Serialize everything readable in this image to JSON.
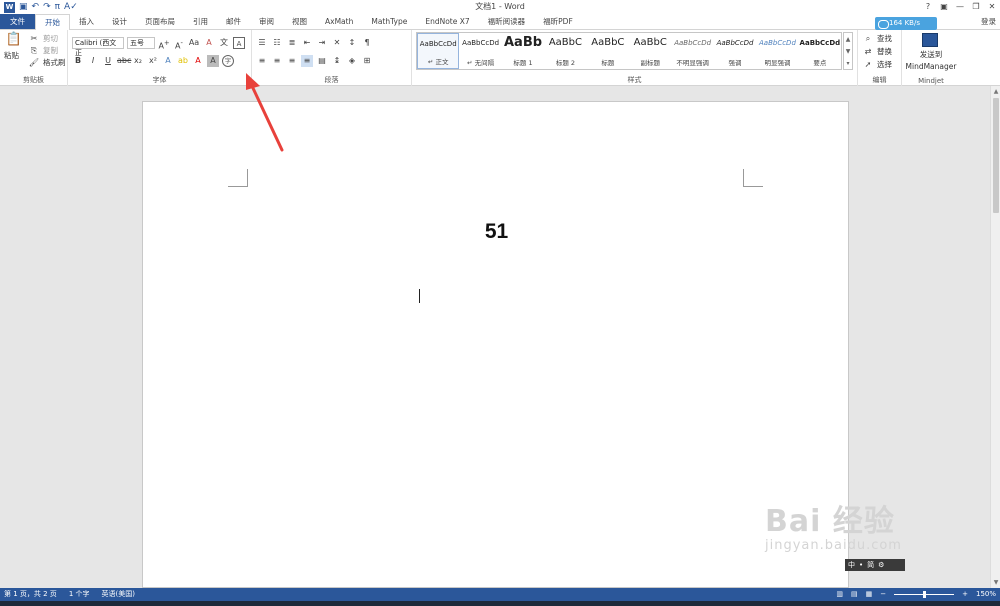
{
  "window": {
    "title": "文档1 - Word",
    "controls": [
      "?",
      "▣",
      "—",
      "❐",
      "✕"
    ]
  },
  "qat": {
    "icons": [
      "word-logo",
      "save-icon",
      "undo-icon",
      "redo-icon",
      "pi-icon",
      "spelling-icon"
    ],
    "pi_label": "π",
    "logo_label": "W"
  },
  "tabs": [
    {
      "label": "文件"
    },
    {
      "label": "开始"
    },
    {
      "label": "插入"
    },
    {
      "label": "设计"
    },
    {
      "label": "页面布局"
    },
    {
      "label": "引用"
    },
    {
      "label": "邮件"
    },
    {
      "label": "审阅"
    },
    {
      "label": "视图"
    },
    {
      "label": "AxMath"
    },
    {
      "label": "MathType"
    },
    {
      "label": "EndNote X7"
    },
    {
      "label": "福昕阅读器"
    },
    {
      "label": "福昕PDF"
    }
  ],
  "login": "登录",
  "cloud_speed": "164 KB/s",
  "ribbon": {
    "clipboard": {
      "label": "剪贴板",
      "paste": "粘贴",
      "cut": "剪切",
      "copy": "复制",
      "format_painter": "格式刷"
    },
    "font": {
      "label": "字体",
      "font_name": "Calibri (西文正",
      "font_size": "五号"
    },
    "paragraph": {
      "label": "段落"
    },
    "styles": {
      "label": "样式",
      "items": [
        {
          "sample": "AaBbCcDd",
          "name": "↵ 正文"
        },
        {
          "sample": "AaBbCcDd",
          "name": "↵ 无间隔"
        },
        {
          "sample": "AaBb",
          "name": "标题 1"
        },
        {
          "sample": "AaBbC",
          "name": "标题 2"
        },
        {
          "sample": "AaBbC",
          "name": "标题"
        },
        {
          "sample": "AaBbC",
          "name": "副标题"
        },
        {
          "sample": "AaBbCcDd",
          "name": "不明显强调"
        },
        {
          "sample": "AaBbCcDd",
          "name": "强调"
        },
        {
          "sample": "AaBbCcDd",
          "name": "明显强调"
        },
        {
          "sample": "AaBbCcDd",
          "name": "要点"
        }
      ]
    },
    "editing": {
      "label": "编辑",
      "find": "查找",
      "replace": "替换",
      "select": "选择"
    },
    "mindjet": {
      "label": "Mindjet",
      "send_line1": "发送到",
      "send_line2": "MindManager"
    }
  },
  "document": {
    "content": "51"
  },
  "ime": {
    "items": [
      "中",
      "•",
      "简",
      "⚙"
    ]
  },
  "watermark": {
    "logo": "Bai 经验",
    "sub": "jingyan.baidu.com"
  },
  "status": {
    "page": "第 1 页，共 2 页",
    "words": "1 个字",
    "lang": "英语(美国)",
    "zoom": "150%",
    "zoom_level": 0.5
  },
  "colors": {
    "accent": "#2b579a",
    "arrow": "#e8413b",
    "cloud": "#4aa3df"
  }
}
